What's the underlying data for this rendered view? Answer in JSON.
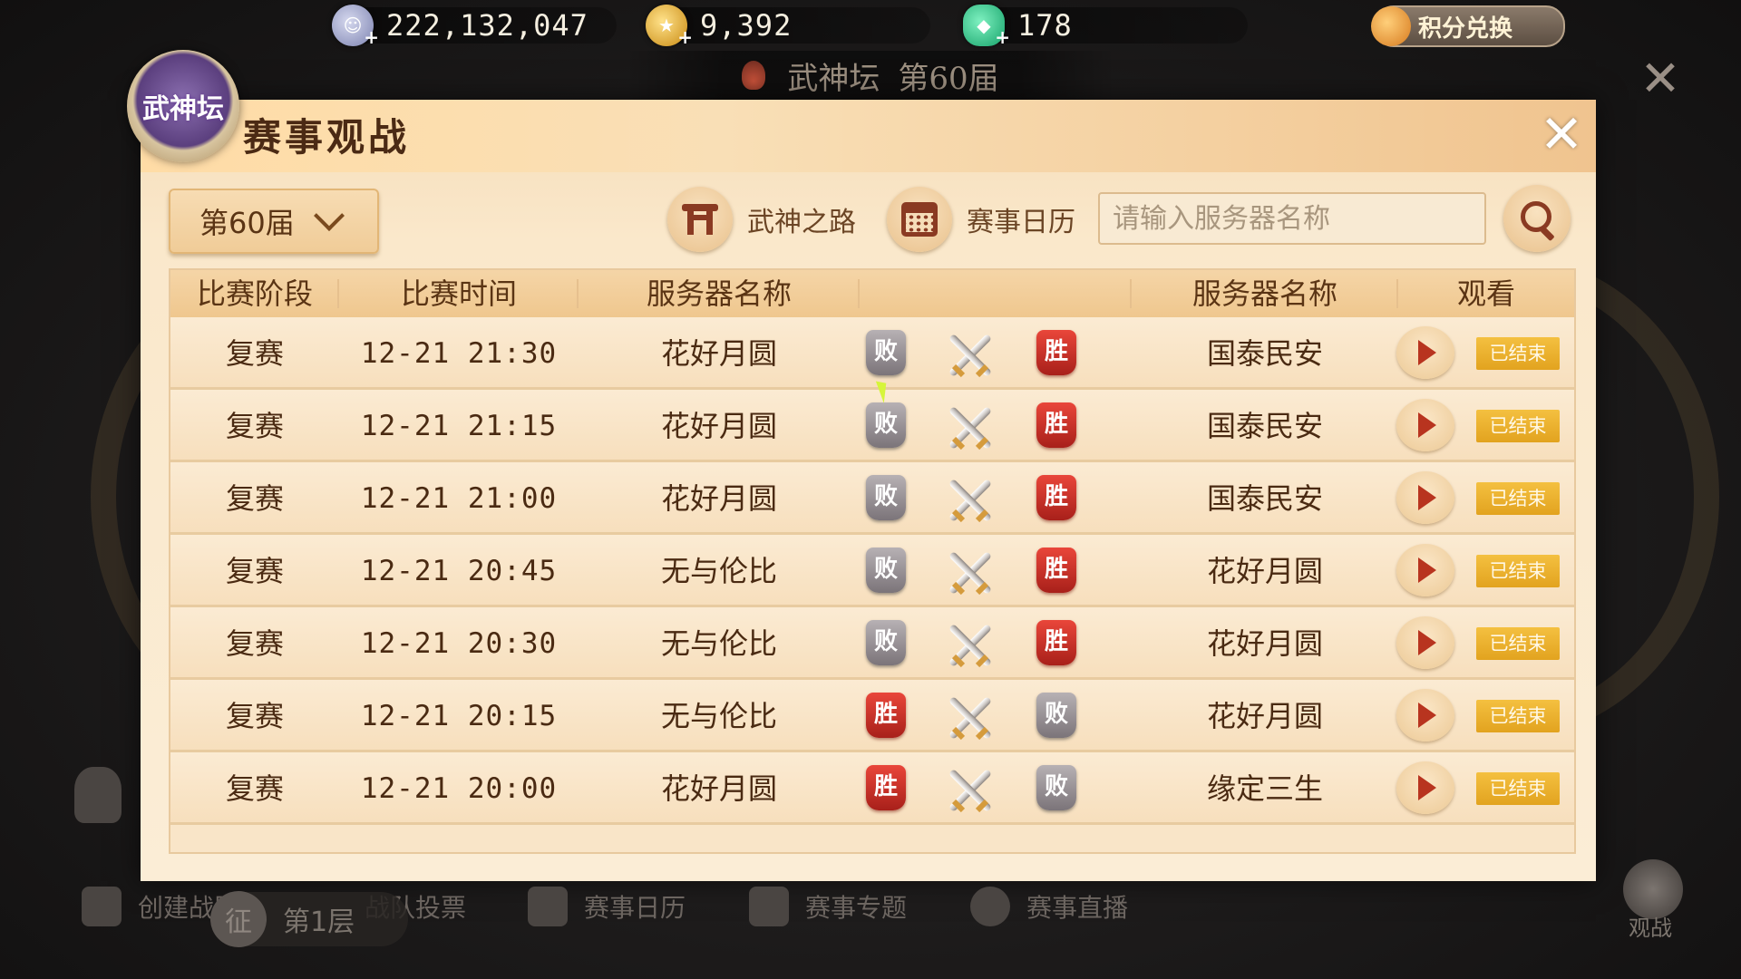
{
  "resources": [
    {
      "icon": "silver-coin-icon",
      "value": "222,132,047",
      "color": "#9aa0c8"
    },
    {
      "icon": "gold-coin-icon",
      "value": "9,392",
      "color": "#e0a52b"
    },
    {
      "icon": "jade-icon",
      "value": "178",
      "color": "#2fc88a"
    }
  ],
  "exchange_label": "积分兑换",
  "event_title": {
    "name": "武神坛",
    "season": "第60届"
  },
  "panel": {
    "title": "赛事观战",
    "emblem_text": "武神坛",
    "season_select": "第60届",
    "road_label": "武神之路",
    "calendar_label": "赛事日历",
    "search_placeholder": "请输入服务器名称"
  },
  "table": {
    "headers": {
      "stage": "比赛阶段",
      "time": "比赛时间",
      "server1": "服务器名称",
      "server2": "服务器名称",
      "watch": "观看"
    },
    "rows": [
      {
        "stage": "复赛",
        "time": "12-21 21:30",
        "server1": "花好月圆",
        "result1": "败",
        "result2": "胜",
        "server2": "国泰民安",
        "status": "已结束"
      },
      {
        "stage": "复赛",
        "time": "12-21 21:15",
        "server1": "花好月圆",
        "result1": "败",
        "result2": "胜",
        "server2": "国泰民安",
        "status": "已结束"
      },
      {
        "stage": "复赛",
        "time": "12-21 21:00",
        "server1": "花好月圆",
        "result1": "败",
        "result2": "胜",
        "server2": "国泰民安",
        "status": "已结束"
      },
      {
        "stage": "复赛",
        "time": "12-21 20:45",
        "server1": "无与伦比",
        "result1": "败",
        "result2": "胜",
        "server2": "花好月圆",
        "status": "已结束"
      },
      {
        "stage": "复赛",
        "time": "12-21 20:30",
        "server1": "无与伦比",
        "result1": "败",
        "result2": "胜",
        "server2": "花好月圆",
        "status": "已结束"
      },
      {
        "stage": "复赛",
        "time": "12-21 20:15",
        "server1": "无与伦比",
        "result1": "胜",
        "result2": "败",
        "server2": "花好月圆",
        "status": "已结束"
      },
      {
        "stage": "复赛",
        "time": "12-21 20:00",
        "server1": "花好月圆",
        "result1": "胜",
        "result2": "败",
        "server2": "缘定三生",
        "status": "已结束"
      }
    ]
  },
  "bottom_menu": {
    "create_team": "创建战队",
    "team_vote": "战队投票",
    "calendar": "赛事日历",
    "topics": "赛事专题",
    "live": "赛事直播",
    "floor_badge": "征",
    "floor": "第1层",
    "watch": "观战"
  },
  "colors": {
    "win": "#d8352a",
    "lose": "#8e888b",
    "status": "#eab32d",
    "title": "#4b2a14"
  }
}
